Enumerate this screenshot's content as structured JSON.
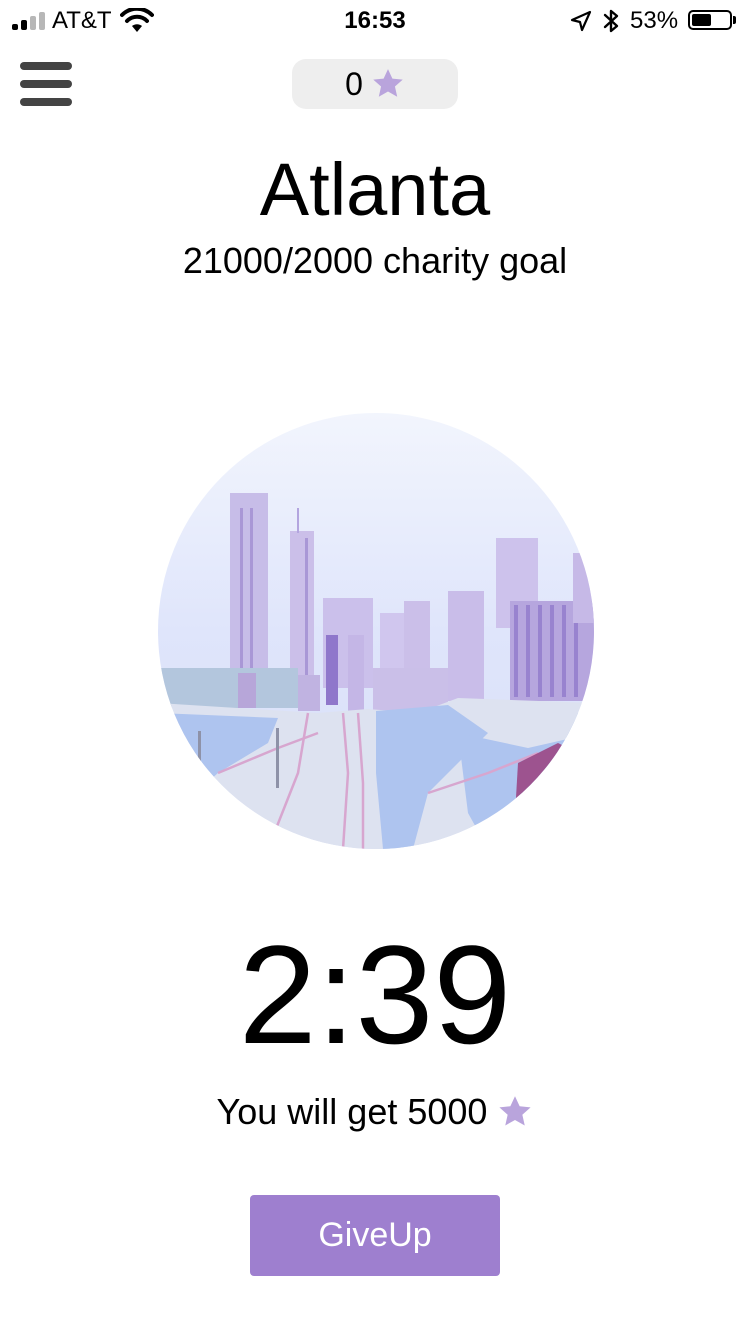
{
  "status_bar": {
    "carrier": "AT&T",
    "time": "16:53",
    "battery_percent": "53%",
    "battery_level": 0.53
  },
  "header": {
    "menu_icon": "hamburger-menu-icon",
    "star_count": "0",
    "star_icon": "star-icon"
  },
  "city": {
    "name": "Atlanta",
    "goal_text": "21000/2000 charity goal",
    "image_icon": "atlanta-skyline-illustration"
  },
  "timer": {
    "value": "2:39"
  },
  "reward": {
    "text": "You will get 5000",
    "icon": "star-icon"
  },
  "actions": {
    "give_up_label": "GiveUp"
  },
  "colors": {
    "accent": "#9e7fcf",
    "star": "#b9a4dc",
    "counter_bg": "#eeeeee",
    "menu_icon": "#444444"
  }
}
